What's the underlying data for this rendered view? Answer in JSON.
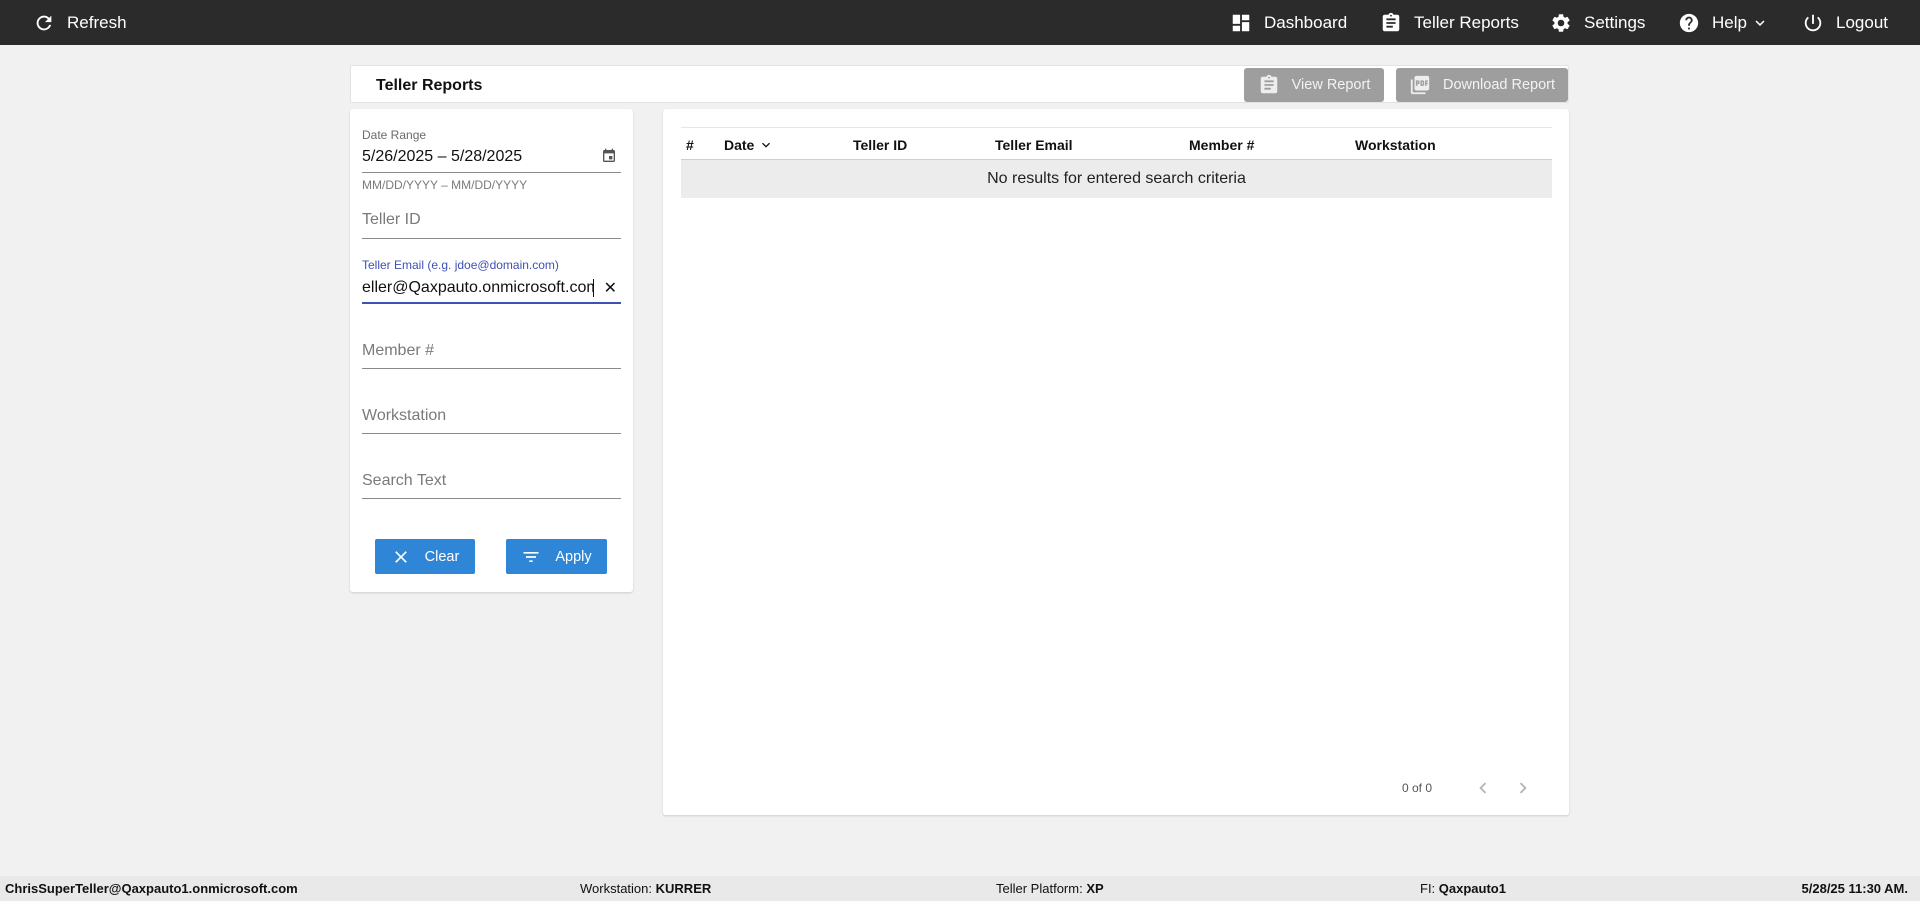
{
  "nav": {
    "refresh_label": "Refresh",
    "dashboard_label": "Dashboard",
    "teller_reports_label": "Teller Reports",
    "settings_label": "Settings",
    "help_label": "Help",
    "logout_label": "Logout"
  },
  "header": {
    "title": "Teller Reports",
    "view_report_label": "View Report",
    "download_report_label": "Download Report"
  },
  "filters": {
    "date_range_label": "Date Range",
    "date_range_value": "5/26/2025 – 5/28/2025",
    "date_range_hint": "MM/DD/YYYY – MM/DD/YYYY",
    "teller_id_placeholder": "Teller ID",
    "teller_email_label": "Teller Email (e.g. jdoe@domain.com)",
    "teller_email_value": "eller@Qaxpauto.onmicrosoft.com",
    "member_placeholder": "Member #",
    "workstation_placeholder": "Workstation",
    "search_text_placeholder": "Search Text",
    "clear_label": "Clear",
    "apply_label": "Apply"
  },
  "table": {
    "columns": [
      "#",
      "Date",
      "Teller ID",
      "Teller Email",
      "Member #",
      "Workstation"
    ],
    "empty_message": "No results for entered search criteria",
    "pager_text": "0 of 0"
  },
  "footer": {
    "user": "ChrisSuperTeller@Qaxpauto1.onmicrosoft.com",
    "workstation_label": "Workstation:",
    "workstation_value": "KURRER",
    "platform_label": "Teller Platform:",
    "platform_value": "XP",
    "fi_label": "FI:",
    "fi_value": "Qaxpauto1",
    "datetime": "5/28/25 11:30 AM."
  },
  "colors": {
    "topbar": "#2b2b2b",
    "primary_button": "#2f86d6",
    "disabled_button": "#9e9e9e",
    "focus_underline": "#3f51b5"
  }
}
